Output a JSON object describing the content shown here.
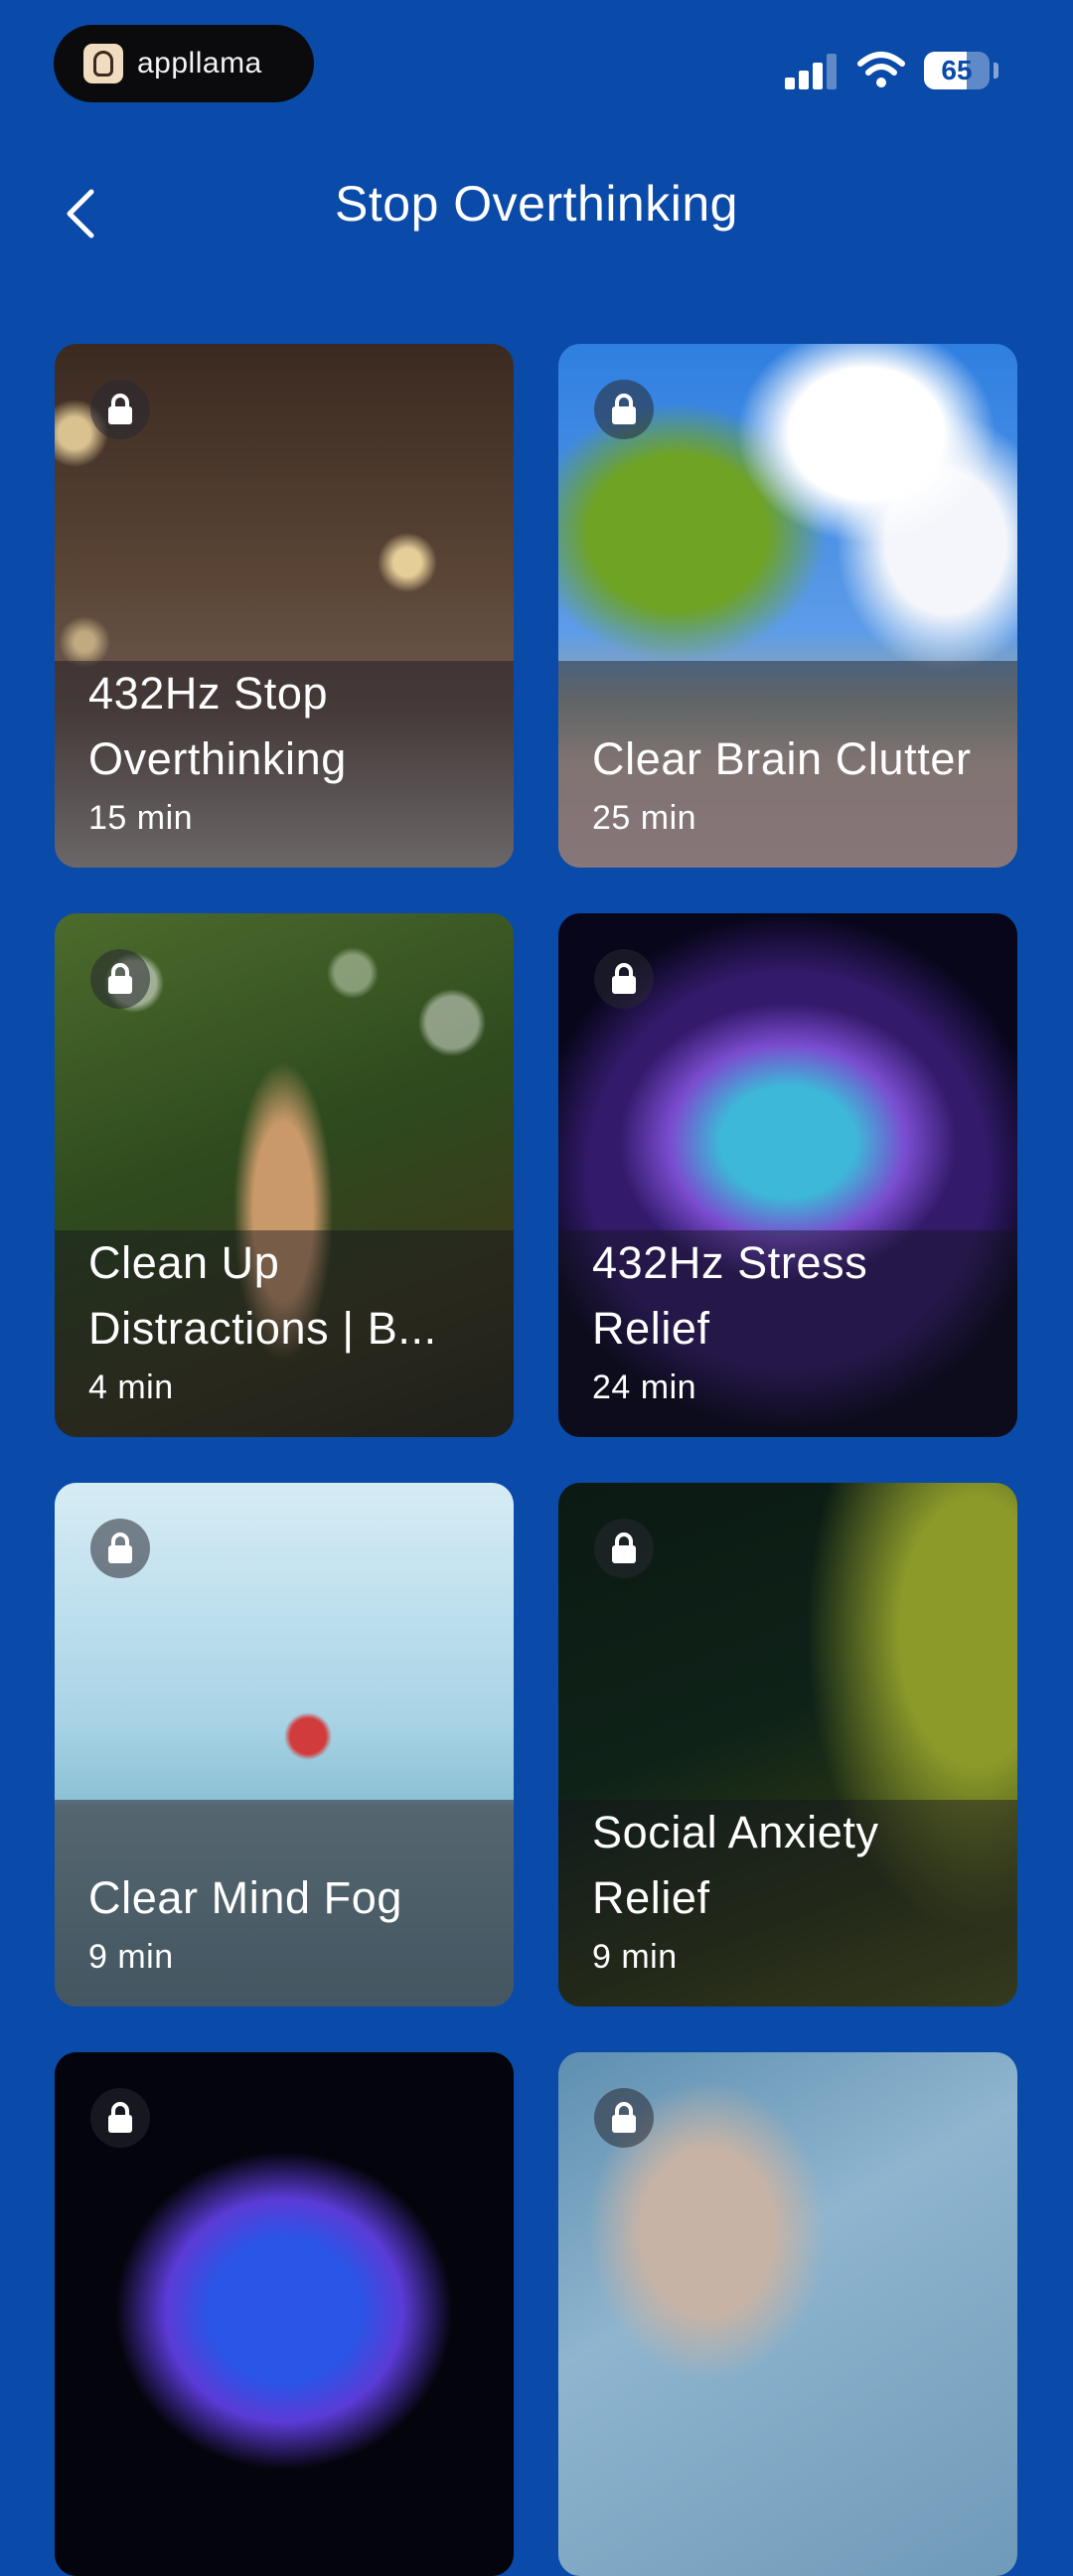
{
  "status_bar": {
    "brand": "appllama",
    "battery": "65",
    "battery_level": 0.65,
    "icons": [
      "signal-icon",
      "wifi-icon",
      "battery-icon"
    ]
  },
  "header": {
    "title": "Stop Overthinking",
    "back_icon": "chevron-left-icon"
  },
  "cards": [
    {
      "title": "432Hz Stop Overthinking",
      "duration": "15 min",
      "locked": true,
      "image": "snowy-street-at-night"
    },
    {
      "title": "Clear Brain Clutter",
      "duration": "25 min",
      "locked": true,
      "image": "tree-and-cloud"
    },
    {
      "title": "Clean Up Distractions | B...",
      "duration": "4 min",
      "locked": true,
      "image": "hanging-shells-bokeh"
    },
    {
      "title": "432Hz Stress Relief",
      "duration": "24 min",
      "locked": true,
      "image": "glowing-brain"
    },
    {
      "title": "Clear Mind Fog",
      "duration": "9 min",
      "locked": true,
      "image": "parachute-over-sea"
    },
    {
      "title": "Social Anxiety Relief",
      "duration": "9 min",
      "locked": true,
      "image": "sunlit-forest"
    },
    {
      "title": "",
      "duration": "",
      "locked": true,
      "image": "neon-brain"
    },
    {
      "title": "",
      "duration": "",
      "locked": true,
      "image": "sleeping-woman"
    }
  ]
}
